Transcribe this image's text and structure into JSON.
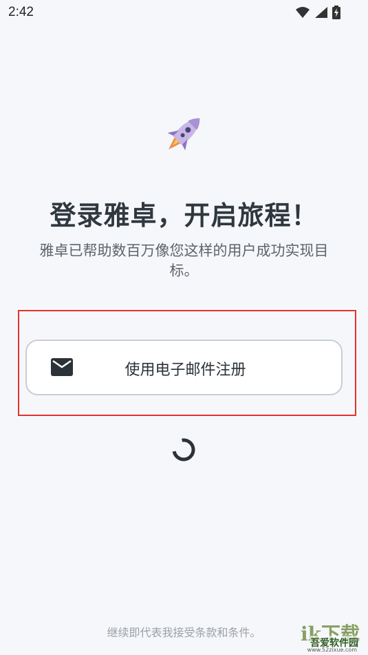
{
  "status_bar": {
    "time": "2:42",
    "icons": [
      "wifi-icon",
      "signal-icon",
      "battery-charging-icon"
    ]
  },
  "header": {
    "title": "登录雅卓，开启旅程！",
    "subtitle": "雅卓已帮助数百万像您这样的用户成功实现目标。",
    "illustration": "rocket-icon"
  },
  "signup": {
    "email_button_label": "使用电子邮件注册",
    "email_icon": "mail-icon"
  },
  "footer": {
    "terms_text": "继续即代表我接受条款和条件。"
  },
  "watermark": {
    "logo_text": "ik下载",
    "brand": "吾爱软件园",
    "url": "www.52zixue.com"
  },
  "colors": {
    "background": "#f6f7fa",
    "highlight_border": "#e2312f",
    "button_border": "#c9cdd2",
    "rocket_body": "#c8b7e6",
    "rocket_flame": "#f08a4b"
  }
}
